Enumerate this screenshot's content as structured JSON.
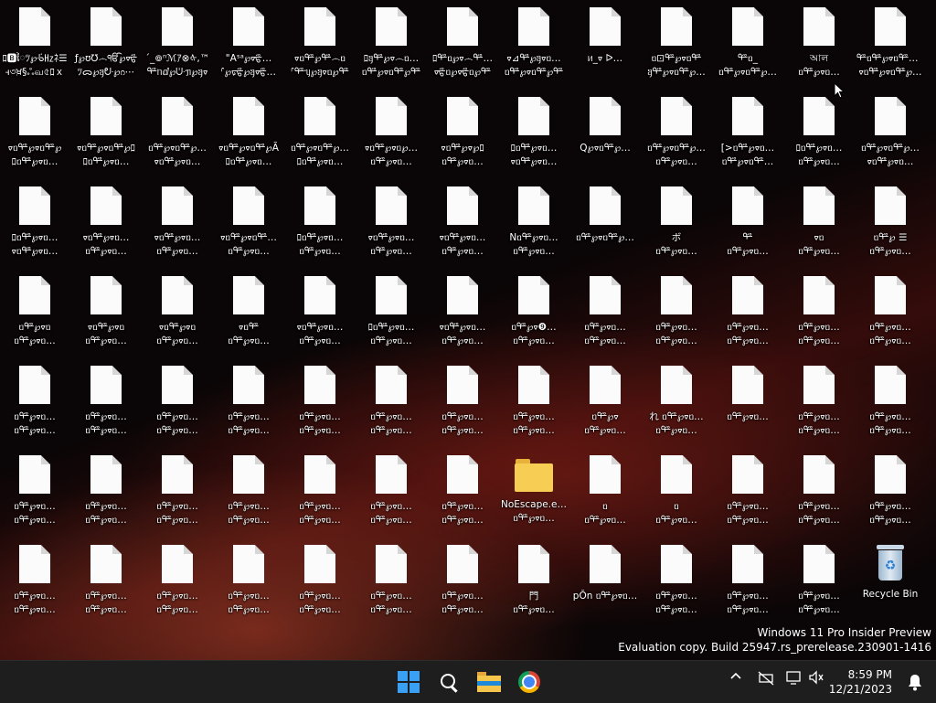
{
  "desktop": {
    "icons": [
      [
        "ﾛ🅱ៃﾂ℘ᢹ㎐ﾈ☰",
        "ꟶ৩ਖ਼§ஃவ৫ﾛｘ",
        "file"
      ],
      [
        "ƒ℘ʊ℧෴ੴ℘ᢦ⁠ᢡ",
        "ﾂᯅ℘ᥠᣣ℘ᦅ⋯",
        "file"
      ],
      [
        "´_៙ⁿℳｱ⊗ᡧ,™",
        "ᢡᥒⅆ℘ᣥᥟ℘ᥠᢦ",
        "file"
      ],
      [
        "\"Aˢᵃ℘ᢦ⁠ᢡ…",
        "ᣗ℘ᢑᢡ℘ᥠᢦ⁠ᢡ…",
        "file"
      ],
      [
        "ᢦᥝᢡ℘ᢡ෴ᥝ",
        "ᣗᢡᥡ℘ᥠᢦᥝ℘ᢡ",
        "file"
      ],
      [
        "ﾛᥠᢡ℘ᢦ෴ᥝ…",
        "ᥝᢡ℘ᢦᥝᢡ℘ᢡ",
        "file"
      ],
      [
        "ﾛᢡᥝ℘ᢦ෴ᢡ…",
        "ᢦᢡᥝ℘ᢦᢡᥝ℘ᢡ",
        "file"
      ],
      [
        "ᢦ⊿ᢡ℘ᥠᢦᥝ…",
        "ᥝᢡ℘ᢦᥝᢡ℘ᢡ",
        "file"
      ],
      [
        "ᥢ_ᢦ ᐅ…",
        "",
        "file"
      ],
      [
        "ᥝ⊡ᢡ℘ᢦᥝᢡ",
        "ᥠᢡ℘ᢦᥝᢡ℘…",
        "file"
      ],
      [
        "ᢡᥝ_",
        "ᥝᢡ℘ᢦᥝᢡ℘…",
        "file"
      ],
      [
        "আল",
        "ᥝᢡ℘ᢦᥝ…",
        "file"
      ],
      [
        "ᢡᥝᢡ℘ᢦᥝᢡ℘…",
        "ᢦᥝᢡ℘ᢦᥝᢡ℘…",
        "file"
      ],
      [
        "ᢦᥝᢡ℘ᢦᥝᢡ℘",
        "ﾛᥝᢡ℘ᢦᥝ…",
        "file"
      ],
      [
        "ᢦᥝᢡ℘ᢦᥝᢡ℘ﾛ",
        "ﾛᥝᢡ℘ᢦᥝ…",
        "file"
      ],
      [
        "ᥝᢡ℘ᢦᥝᢡ℘…",
        "ᢦᥝᢡ℘ᢦᥝ…",
        "file"
      ],
      [
        "ᢦᥝᢡ℘ᢦᥝᢡ℘Ã",
        "ﾛᥝᢡ℘ᢦᥝ…",
        "file"
      ],
      [
        "ᥝᢡ℘ᢦᥝᢡ℘…",
        "ﾛᥝᢡ℘ᢦᥝ…",
        "file"
      ],
      [
        "ᢦᥝᢡ℘ᢦᥝ℘…",
        "ᥝᢡ℘ᢦᥝ…",
        "file"
      ],
      [
        "ᢦᥝᢡ℘ᢦ℘ﾛ",
        "ᥝᢡ℘ᢦᥝ…",
        "file"
      ],
      [
        "ﾛᥝᢡ℘ᢦᥝ…",
        "ᢦᥝᢡ℘ᢦᥝ…",
        "file"
      ],
      [
        "Q℘ᢦᥝᢡ℘…",
        "",
        "file"
      ],
      [
        "ᥝᢡ℘ᢦᥝᢡ℘…",
        "ᥝᢡ℘ᢦᥝ…",
        "file"
      ],
      [
        "[>ᥝᢡ℘ᢦᥝ…",
        "ᥝᢡ℘ᢦᥝᢡ…",
        "file"
      ],
      [
        "ﾛᥝᢡ℘ᢦᥝ…",
        "ᥝᢡ℘ᢦᥝ…",
        "file"
      ],
      [
        "ᥝᢡ℘ᢦᥝᢡ℘…",
        "ᢦᥝᢡ℘ᢦᥝ…",
        "file"
      ],
      [
        "ﾛᥝᢡ℘ᢦᥝ…",
        "ᢦᥝᢡ℘ᢦᥝ…",
        "file"
      ],
      [
        "ᢦᥝᢡ℘ᢦᥝ…",
        "ᥝᢡ℘ᢦᥝ…",
        "file"
      ],
      [
        "ᢦᥝᢡ℘ᢦᥝ…",
        "ᥝᢡ℘ᢦᥝ…",
        "file"
      ],
      [
        "ᢦᥝᢡ℘ᢦᥝᢡ…",
        "ᥝᢡ℘ᢦᥝ…",
        "file"
      ],
      [
        "ﾛᥝᢡ℘ᢦᥝ…",
        "ᥝᢡ℘ᢦᥝ…",
        "file"
      ],
      [
        "ᢦᥝᢡ℘ᢦᥝ…",
        "ᥝᢡ℘ᢦᥝ…",
        "file"
      ],
      [
        "ᢦᥝᢡ℘ᢦᥝ…",
        "ᥝᢡ℘ᢦᥝ…",
        "file"
      ],
      [
        "Nᥝᢡ℘ᢦᥝ…",
        "ᥝᢡ℘ᢦᥝ…",
        "file"
      ],
      [
        "ᥝᢡ℘ᢦᥝᢡ℘…",
        "",
        "file"
      ],
      [
        "ボ",
        "ᥝᢡ℘ᢦᥝ…",
        "file"
      ],
      [
        "ᢡ",
        "ᥝᢡ℘ᢦᥝ…",
        "file"
      ],
      [
        "ᢦᥝ",
        "ᥝᢡ℘ᢦᥝ…",
        "file"
      ],
      [
        "ᥝᢡ℘  ☰",
        "ᥝᢡ℘ᢦᥝ…",
        "file"
      ],
      [
        "ᥝᢡ℘ᢦᥝ",
        "ᥝᢡ℘ᢦᥝ…",
        "file"
      ],
      [
        "ᢦᥝᢡ℘ᢦᥝ",
        "ᥝᢡ℘ᢦᥝ…",
        "file"
      ],
      [
        "ᢦᥝᢡ℘ᢦᥝ",
        "ᥝᢡ℘ᢦᥝ…",
        "file"
      ],
      [
        "ᢦᥝᢡ",
        "ᥝᢡ℘ᢦᥝ…",
        "file"
      ],
      [
        "ᢦᥝᢡ℘ᢦᥝ…",
        "ᥝᢡ℘ᢦᥝ…",
        "file"
      ],
      [
        "ﾛᥝᢡ℘ᢦᥝ…",
        "ᥝᢡ℘ᢦᥝ…",
        "file"
      ],
      [
        "ᢦᥝᢡ℘ᢦᥝ…",
        "ᥝᢡ℘ᢦᥝ…",
        "file"
      ],
      [
        "ᥝᢡ℘ᢦ❾…",
        "ᥝᢡ℘ᢦᥝ…",
        "file"
      ],
      [
        "ᥝᢡ℘ᢦᥝ…",
        "ᥝᢡ℘ᢦᥝ…",
        "file"
      ],
      [
        "ᥝᢡ℘ᢦᥝ…",
        "ᥝᢡ℘ᢦᥝ…",
        "file"
      ],
      [
        "ᥝᢡ℘ᢦᥝ…",
        "ᥝᢡ℘ᢦᥝ…",
        "file"
      ],
      [
        "ᥝᢡ℘ᢦᥝ…",
        "ᥝᢡ℘ᢦᥝ…",
        "file"
      ],
      [
        "ᥝᢡ℘ᢦᥝ…",
        "ᥝᢡ℘ᢦᥝ…",
        "file"
      ],
      [
        "ᥝᢡ℘ᢦᥝ…",
        "ᥝᢡ℘ᢦᥝ…",
        "file"
      ],
      [
        "ᥝᢡ℘ᢦᥝ…",
        "ᥝᢡ℘ᢦᥝ…",
        "file"
      ],
      [
        "ᥝᢡ℘ᢦᥝ…",
        "ᥝᢡ℘ᢦᥝ…",
        "file"
      ],
      [
        "ᥝᢡ℘ᢦᥝ…",
        "ᥝᢡ℘ᢦᥝ…",
        "file"
      ],
      [
        "ᥝᢡ℘ᢦᥝ…",
        "ᥝᢡ℘ᢦᥝ…",
        "file"
      ],
      [
        "ᥝᢡ℘ᢦᥝ…",
        "ᥝᢡ℘ᢦᥝ…",
        "file"
      ],
      [
        "ᥝᢡ℘ᢦᥝ…",
        "ᥝᢡ℘ᢦᥝ…",
        "file"
      ],
      [
        "ᥝᢡ℘ᢦᥝ…",
        "ᥝᢡ℘ᢦᥝ…",
        "file"
      ],
      [
        "ᥝᢡ℘ᢦ",
        "ᥝᢡ℘ᢦᥝ…",
        "file"
      ],
      [
        "れ ᥝᢡ℘ᢦᥝ…",
        "ᥝᢡ℘ᢦᥝ…",
        "file"
      ],
      [
        "ᥝᢡ℘ᢦᥝ…",
        "",
        "file"
      ],
      [
        "ᥝᢡ℘ᢦᥝ…",
        "ᥝᢡ℘ᢦᥝ…",
        "file"
      ],
      [
        "ᥝᢡ℘ᢦᥝ…",
        "ᥝᢡ℘ᢦᥝ…",
        "file"
      ],
      [
        "ᥝᢡ℘ᢦᥝ…",
        "ᥝᢡ℘ᢦᥝ…",
        "file"
      ],
      [
        "ᥝᢡ℘ᢦᥝ…",
        "ᥝᢡ℘ᢦᥝ…",
        "file"
      ],
      [
        "ᥝᢡ℘ᢦᥝ…",
        "ᥝᢡ℘ᢦᥝ…",
        "file"
      ],
      [
        "ᥝᢡ℘ᢦᥝ…",
        "ᥝᢡ℘ᢦᥝ…",
        "file"
      ],
      [
        "ᥝᢡ℘ᢦᥝ…",
        "ᥝᢡ℘ᢦᥝ…",
        "file"
      ],
      [
        "ᥝᢡ℘ᢦᥝ…",
        "ᥝᢡ℘ᢦᥝ…",
        "file"
      ],
      [
        "ᥝᢡ℘ᢦᥝ…",
        "ᥝᢡ℘ᢦᥝ…",
        "file"
      ],
      [
        "NoEscape.e…",
        "ᥝᢡ℘ᢦᥝ…",
        "folder"
      ],
      [
        "ᥝ",
        "ᥝᢡ℘ᢦᥝ…",
        "file"
      ],
      [
        "ᥝ",
        "ᥝᢡ℘ᢦᥝ…",
        "file"
      ],
      [
        "ᥝᢡ℘ᢦᥝ…",
        "ᥝᢡ℘ᢦᥝ…",
        "file"
      ],
      [
        "ᥝᢡ℘ᢦᥝ…",
        "ᥝᢡ℘ᢦᥝ…",
        "file"
      ],
      [
        "ᥝᢡ℘ᢦᥝ…",
        "ᥝᢡ℘ᢦᥝ…",
        "file"
      ],
      [
        "ᥝᢡ℘ᢦᥝ…",
        "ᥝᢡ℘ᢦᥝ…",
        "file"
      ],
      [
        "ᥝᢡ℘ᢦᥝ…",
        "ᥝᢡ℘ᢦᥝ…",
        "file"
      ],
      [
        "ᥝᢡ℘ᢦᥝ…",
        "ᥝᢡ℘ᢦᥝ…",
        "file"
      ],
      [
        "ᥝᢡ℘ᢦᥝ…",
        "ᥝᢡ℘ᢦᥝ…",
        "file"
      ],
      [
        "ᥝᢡ℘ᢦᥝ…",
        "ᥝᢡ℘ᢦᥝ…",
        "file"
      ],
      [
        "ᥝᢡ℘ᢦᥝ…",
        "ᥝᢡ℘ᢦᥝ…",
        "file"
      ],
      [
        "ᥝᢡ℘ᢦᥝ…",
        "ᥝᢡ℘ᢦᥝ…",
        "file"
      ],
      [
        "門",
        "ᥝᢡ℘ᢦᥝ…",
        "file"
      ],
      [
        "pǑn ᥝᢡ℘ᢦᥝ…",
        "",
        "file"
      ],
      [
        "ᥝᢡ℘ᢦᥝ…",
        "ᥝᢡ℘ᢦᥝ…",
        "file"
      ],
      [
        "ᥝᢡ℘ᢦᥝ…",
        "ᥝᢡ℘ᢦᥝ…",
        "file"
      ],
      [
        "ᥝᢡ℘ᢦᥝ…",
        "ᥝᢡ℘ᢦᥝ…",
        "file"
      ],
      [
        "Recycle Bin",
        "",
        "bin"
      ]
    ]
  },
  "watermark": {
    "line1": "Windows 11 Pro Insider Preview",
    "line2": "Evaluation copy. Build 25947.rs_prerelease.230901-1416"
  },
  "taskbar": {
    "pinned": [
      "start-icon",
      "search-icon",
      "file-explorer-icon",
      "chrome-icon"
    ],
    "tray": [
      "chevron-up-icon",
      "network-icon",
      "display-icon",
      "volume-icon"
    ],
    "clock": {
      "time": "8:59 PM",
      "date": "12/21/2023"
    }
  },
  "colors": {
    "taskbar_bg": "#1e1e1e",
    "start_blue": "#3aa0f3",
    "folder_yellow": "#f8cd53"
  }
}
